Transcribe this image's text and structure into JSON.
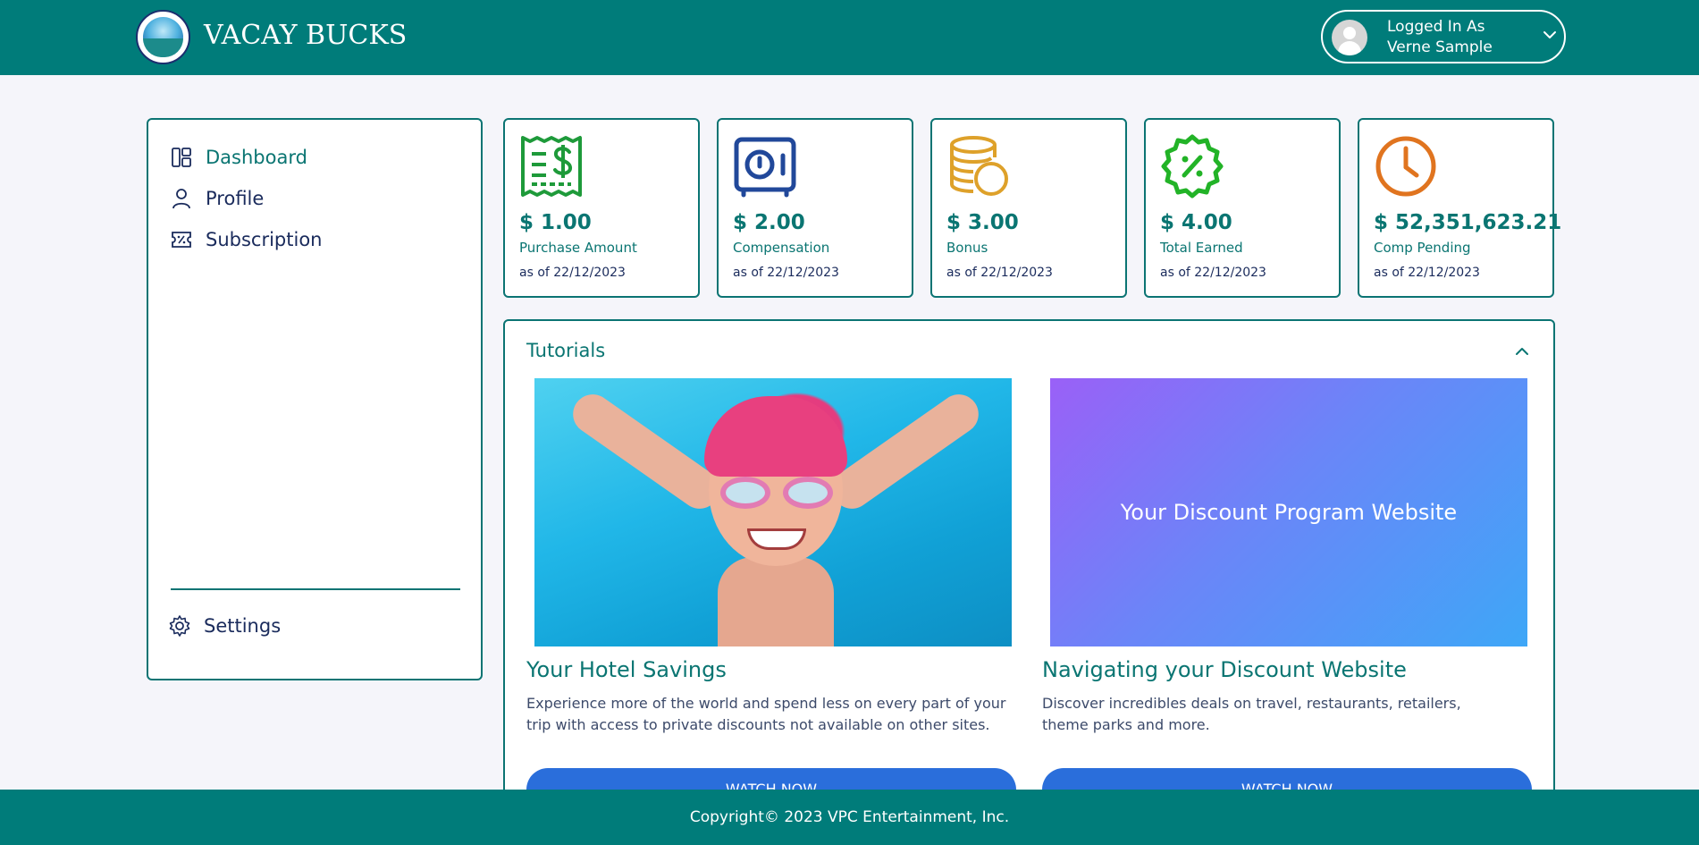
{
  "header": {
    "brand": "VACAY BUCKS",
    "user": {
      "label": "Logged In As",
      "name": "Verne Sample"
    }
  },
  "sidebar": {
    "items": [
      {
        "label": "Dashboard",
        "icon": "dashboard-icon",
        "active": true
      },
      {
        "label": "Profile",
        "icon": "user-icon",
        "active": false
      },
      {
        "label": "Subscription",
        "icon": "coupon-icon",
        "active": false
      }
    ],
    "settings": {
      "label": "Settings",
      "icon": "gear-icon"
    }
  },
  "stats": [
    {
      "amount": "$ 1.00",
      "label": "Purchase Amount",
      "asof": "as of 22/12/2023",
      "icon": "receipt-dollar-icon",
      "color": "#1e9a3a"
    },
    {
      "amount": "$ 2.00",
      "label": "Compensation",
      "asof": "as of 22/12/2023",
      "icon": "safe-icon",
      "color": "#21489a"
    },
    {
      "amount": "$ 3.00",
      "label": "Bonus",
      "asof": "as of 22/12/2023",
      "icon": "coins-icon",
      "color": "#dea12a"
    },
    {
      "amount": "$ 4.00",
      "label": "Total Earned",
      "asof": "as of 22/12/2023",
      "icon": "percent-badge-icon",
      "color": "#22b327"
    },
    {
      "amount": "$ 52,351,623.21",
      "label": "Comp Pending",
      "asof": "as of 22/12/2023",
      "icon": "clock-icon",
      "color": "#e0741f"
    }
  ],
  "tutorials": {
    "title": "Tutorials",
    "items": [
      {
        "heading": "Your Hotel Savings",
        "description": "Experience more of the world and spend less on every part of your trip with access to private discounts not available on other sites.",
        "button": "WATCH NOW",
        "thumbnail": "girl-swimming-underwater-image"
      },
      {
        "heading": "Navigating your Discount Website",
        "description": "Discover incredibles deals on travel, restaurants, retailers, theme parks and more.",
        "button": "WATCH NOW",
        "thumbnail_text": "Your Discount Program Website"
      }
    ]
  },
  "footer": {
    "copyright": "Copyright© 2023 VPC Entertainment, Inc."
  },
  "colors": {
    "brand_teal": "#007c7a",
    "accent_blue": "#2a6edb",
    "background": "#f5f5fa"
  }
}
